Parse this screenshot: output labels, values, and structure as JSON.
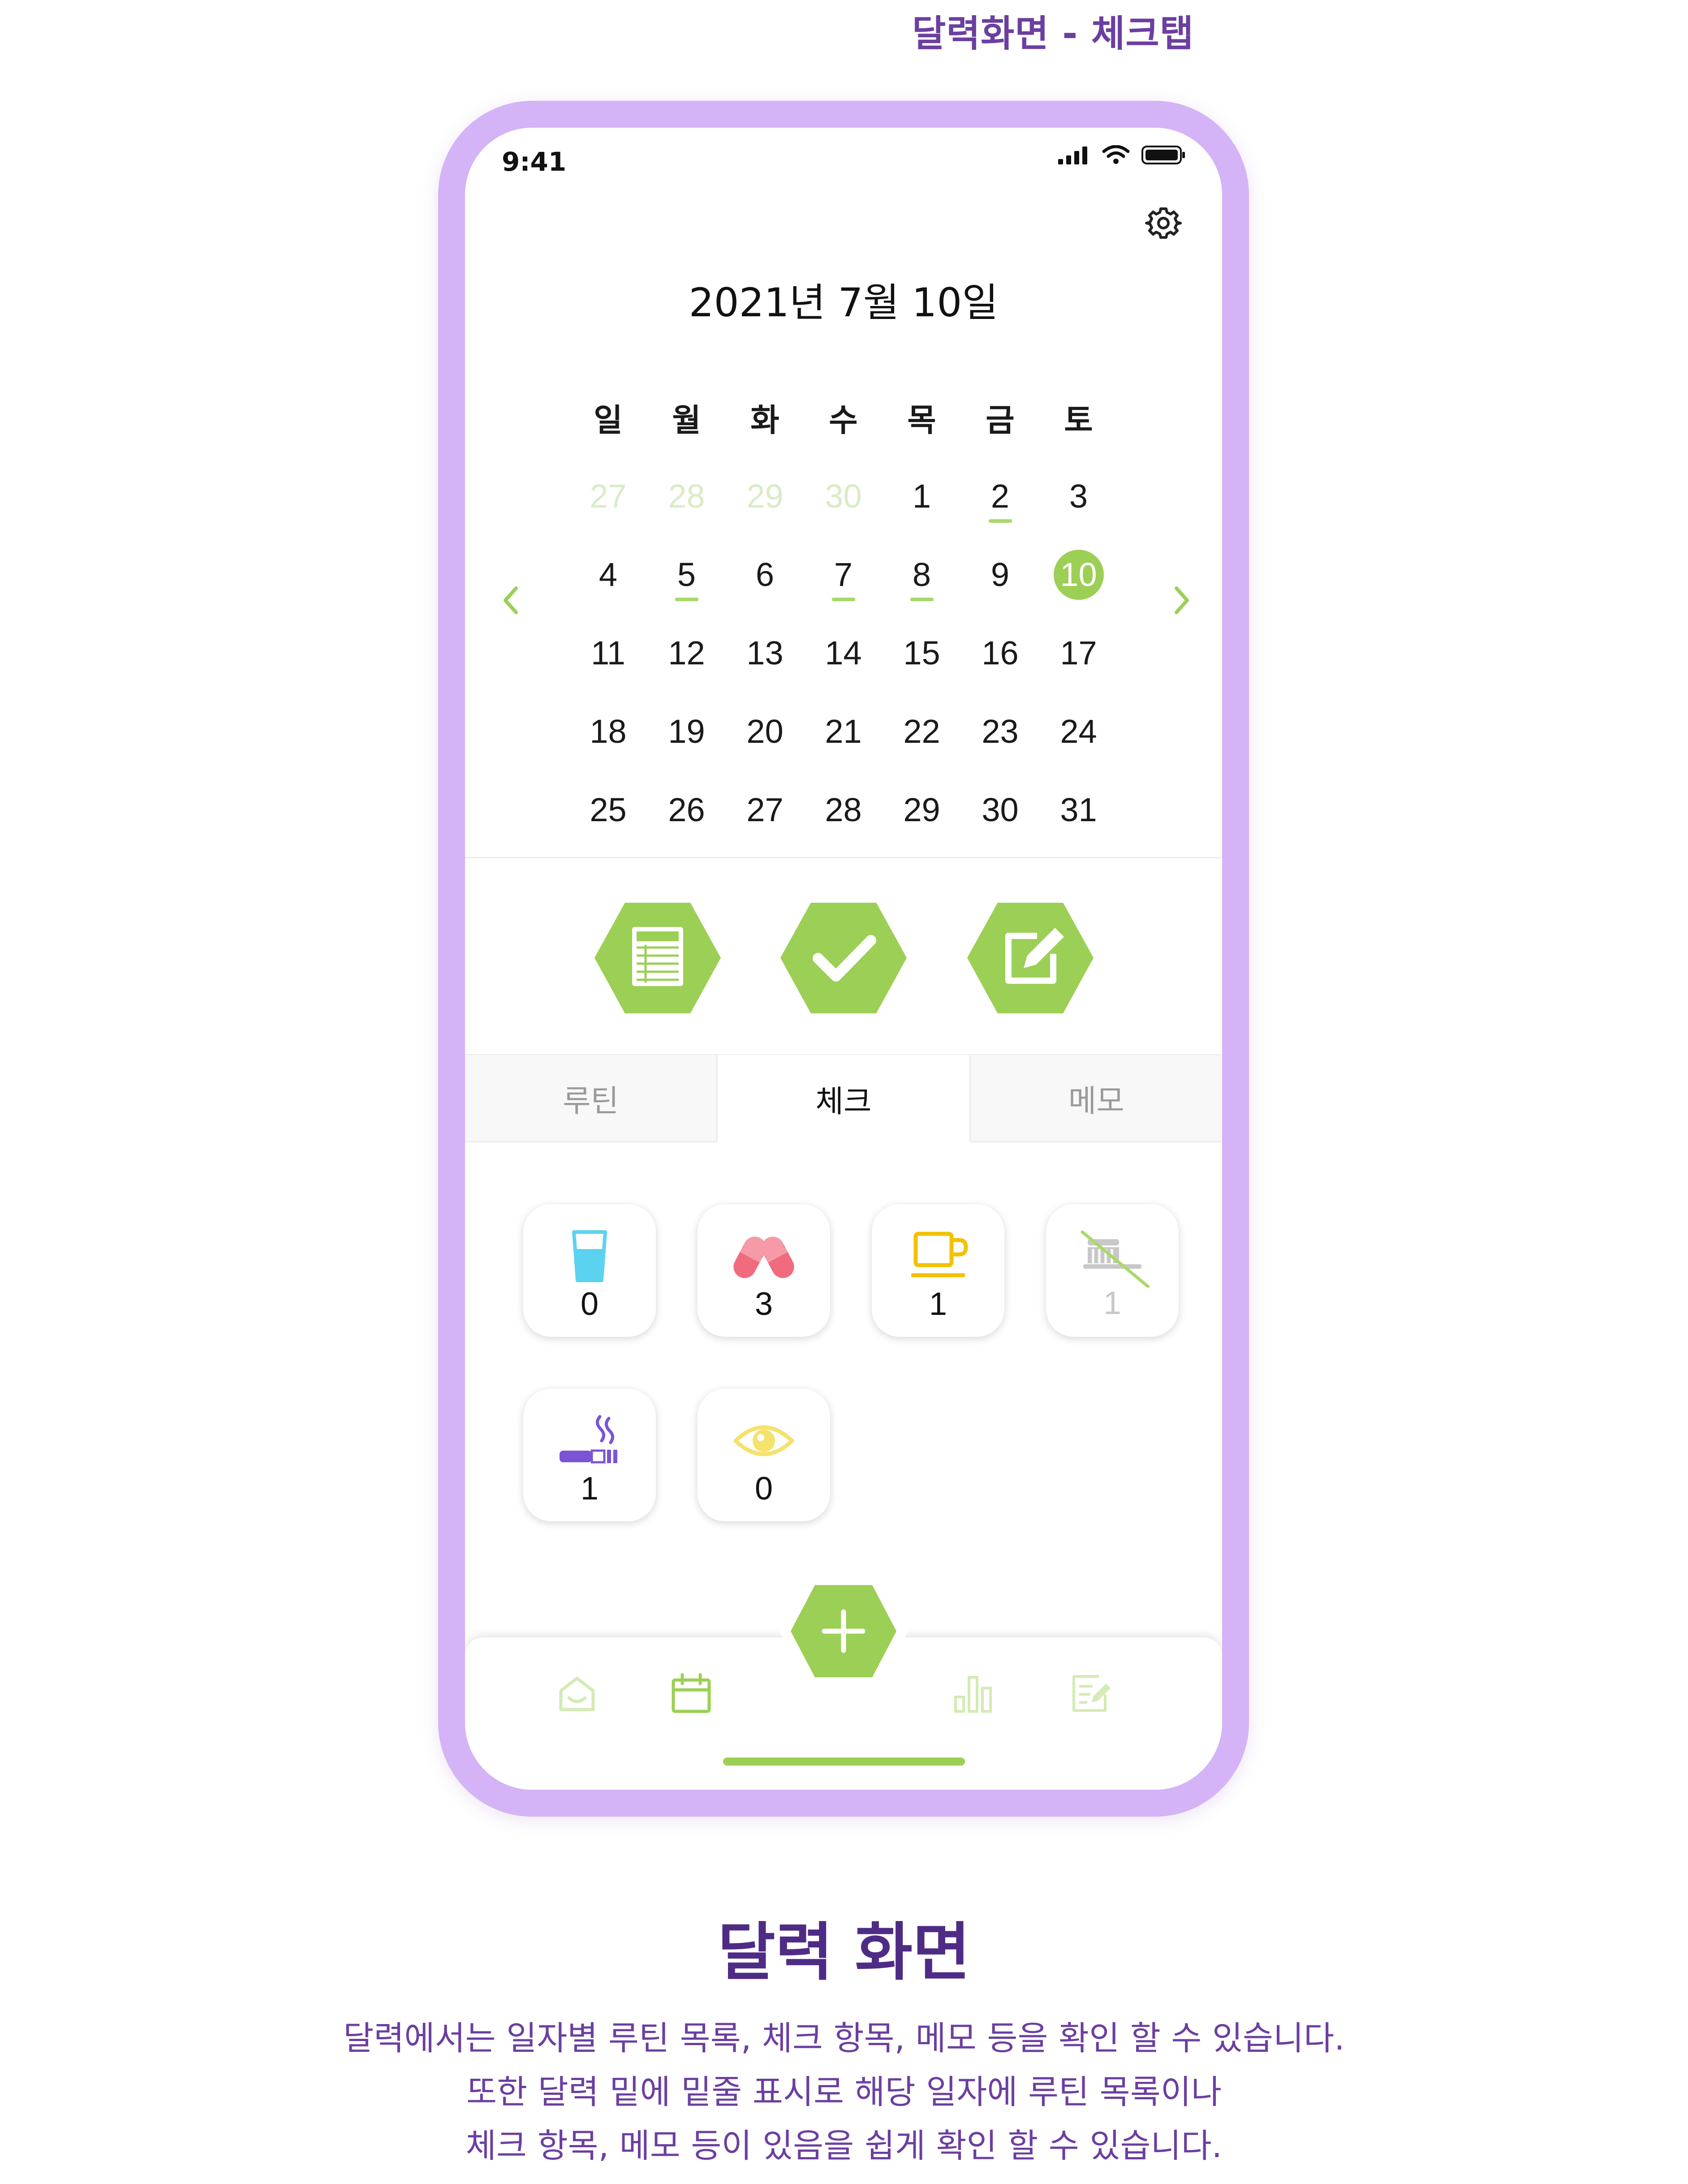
{
  "page_heading": "달력화면 - 체크탭",
  "status_bar": {
    "time": "9:41"
  },
  "calendar": {
    "title": "2021년 7월 10일",
    "weekdays": [
      "일",
      "월",
      "화",
      "수",
      "목",
      "금",
      "토"
    ],
    "weeks": [
      [
        {
          "d": "27",
          "faded": true
        },
        {
          "d": "28",
          "faded": true
        },
        {
          "d": "29",
          "faded": true
        },
        {
          "d": "30",
          "faded": true
        },
        {
          "d": "1"
        },
        {
          "d": "2",
          "mark": true
        },
        {
          "d": "3"
        }
      ],
      [
        {
          "d": "4"
        },
        {
          "d": "5",
          "mark": true
        },
        {
          "d": "6"
        },
        {
          "d": "7",
          "mark": true
        },
        {
          "d": "8",
          "mark": true
        },
        {
          "d": "9"
        },
        {
          "d": "10",
          "selected": true
        }
      ],
      [
        {
          "d": "11"
        },
        {
          "d": "12"
        },
        {
          "d": "13"
        },
        {
          "d": "14"
        },
        {
          "d": "15"
        },
        {
          "d": "16"
        },
        {
          "d": "17"
        }
      ],
      [
        {
          "d": "18"
        },
        {
          "d": "19"
        },
        {
          "d": "20"
        },
        {
          "d": "21"
        },
        {
          "d": "22"
        },
        {
          "d": "23"
        },
        {
          "d": "24"
        }
      ],
      [
        {
          "d": "25"
        },
        {
          "d": "26"
        },
        {
          "d": "27"
        },
        {
          "d": "28"
        },
        {
          "d": "29"
        },
        {
          "d": "30"
        },
        {
          "d": "31"
        }
      ]
    ]
  },
  "tabs": {
    "routine": "루틴",
    "check": "체크",
    "memo": "메모",
    "active": "check"
  },
  "check_items": [
    {
      "icon": "water-glass-icon",
      "count": "0",
      "color": "#5bd3f0",
      "disabled": false
    },
    {
      "icon": "pills-icon",
      "count": "3",
      "color": "#f06b7e",
      "disabled": false
    },
    {
      "icon": "coffee-cup-icon",
      "count": "1",
      "color": "#f2c200",
      "disabled": false
    },
    {
      "icon": "toothbrush-icon",
      "count": "1",
      "color": "#bdbdbd",
      "disabled": true
    },
    {
      "icon": "cigarette-icon",
      "count": "1",
      "color": "#7b54d6",
      "disabled": false
    },
    {
      "icon": "eye-icon",
      "count": "0",
      "color": "#f5e26b",
      "disabled": false
    }
  ],
  "colors": {
    "accent": "#9ccf55",
    "frame": "#d4b3f7",
    "heading": "#6b3fa0"
  },
  "caption": {
    "title": "달력 화면",
    "lines": [
      "달력에서는 일자별 루틴 목록, 체크 항목, 메모 등을 확인 할 수 있습니다.",
      "또한 달력 밑에 밑줄 표시로 해당 일자에 루틴 목록이나",
      "체크 항목, 메모 등이 있음을 쉽게 확인 할 수 있습니다."
    ]
  }
}
